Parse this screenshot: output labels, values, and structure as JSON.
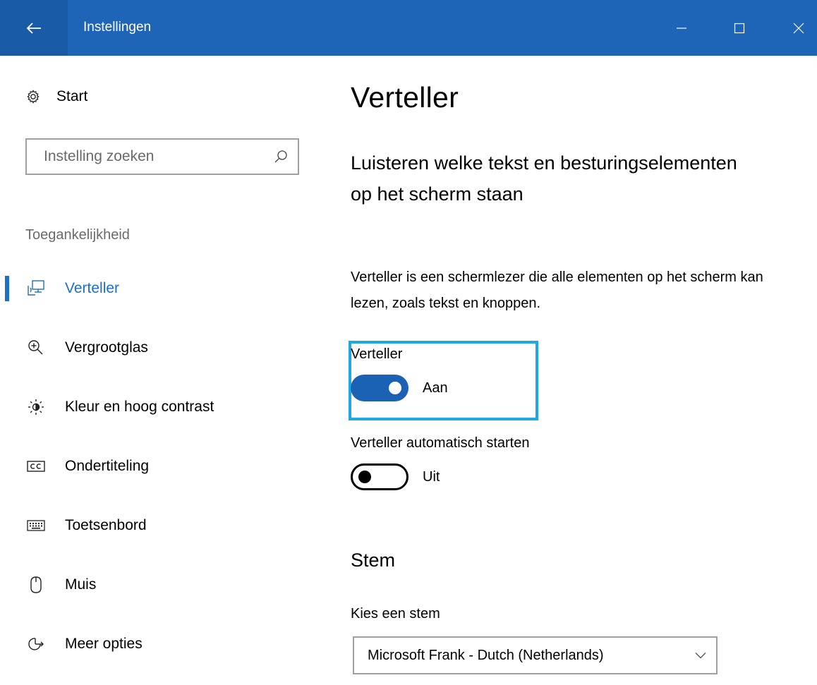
{
  "window": {
    "title": "Instellingen",
    "colors": {
      "titlebar": "#1f65b7",
      "back_area": "#1a5ba7",
      "accent": "#1e6fc8",
      "highlight": "#1ea9e3",
      "toggle_on": "#1b62b4"
    },
    "controls": {
      "back": "back-arrow-icon",
      "minimize": "minimize-icon",
      "maximize": "maximize-icon",
      "close": "close-icon"
    }
  },
  "sidebar": {
    "home_label": "Start",
    "home_icon": "gear-icon",
    "search_placeholder": "Instelling zoeken",
    "search_icon": "search-icon",
    "section_label": "Toegankelijkheid",
    "items": [
      {
        "label": "Verteller",
        "icon": "narrator-icon",
        "active": true
      },
      {
        "label": "Vergrootglas",
        "icon": "magnifier-icon",
        "active": false
      },
      {
        "label": "Kleur en hoog contrast",
        "icon": "brightness-icon",
        "active": false
      },
      {
        "label": "Ondertiteling",
        "icon": "closed-captions-icon",
        "active": false
      },
      {
        "label": "Toetsenbord",
        "icon": "keyboard-icon",
        "active": false
      },
      {
        "label": "Muis",
        "icon": "mouse-icon",
        "active": false
      },
      {
        "label": "Meer opties",
        "icon": "more-options-icon",
        "active": false
      }
    ]
  },
  "main": {
    "title": "Verteller",
    "section_heading": "Luisteren welke tekst en besturingselementen op het scherm staan",
    "description": "Verteller is een schermlezer die alle elementen op het scherm kan lezen, zoals tekst en knoppen.",
    "narrator_toggle": {
      "label": "Verteller",
      "state": "Aan",
      "on": true
    },
    "autostart_toggle": {
      "label": "Verteller automatisch starten",
      "state": "Uit",
      "on": false
    },
    "voice_heading": "Stem",
    "voice_label": "Kies een stem",
    "voice_value": "Microsoft Frank - Dutch (Netherlands)",
    "voice_dropdown_icon": "chevron-down-icon"
  }
}
